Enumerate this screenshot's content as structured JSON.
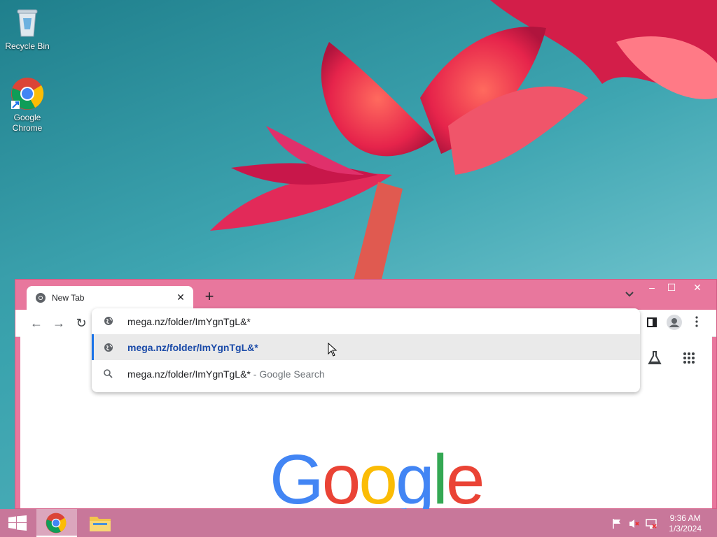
{
  "desktop": {
    "icons": [
      {
        "label": "Recycle Bin",
        "icon": "recycle-bin-icon"
      },
      {
        "label": "Google\nChrome",
        "icon": "chrome-icon"
      }
    ]
  },
  "browser": {
    "tab": {
      "title": "New Tab",
      "close": "✕"
    },
    "new_tab_label": "+",
    "tab_list_label": "⌄",
    "window_controls": {
      "minimize": "–",
      "maximize": "☐",
      "close": "✕"
    },
    "toolbar": {
      "back": "←",
      "forward": "→",
      "reload": "↻"
    },
    "omnibox": {
      "input_value": "mega.nz/folder/ImYgnTgL&*",
      "suggestions": [
        {
          "text": "mega.nz/folder/ImYgnTgL&*",
          "icon": "globe-icon",
          "selected": true
        },
        {
          "text": "mega.nz/folder/ImYgnTgL&*",
          "suffix": " - Google Search",
          "icon": "search-icon",
          "selected": false
        }
      ]
    },
    "google_logo": [
      "G",
      "o",
      "o",
      "g",
      "l",
      "e"
    ],
    "colors": {
      "blue": "#4285f4",
      "red": "#ea4335",
      "yellow": "#fbbc05",
      "green": "#34a853"
    }
  },
  "taskbar": {
    "clock": {
      "time": "9:36 AM",
      "date": "1/3/2024"
    },
    "items": [
      "start-button",
      "chrome-taskbar-icon",
      "file-explorer-taskbar-icon"
    ]
  }
}
